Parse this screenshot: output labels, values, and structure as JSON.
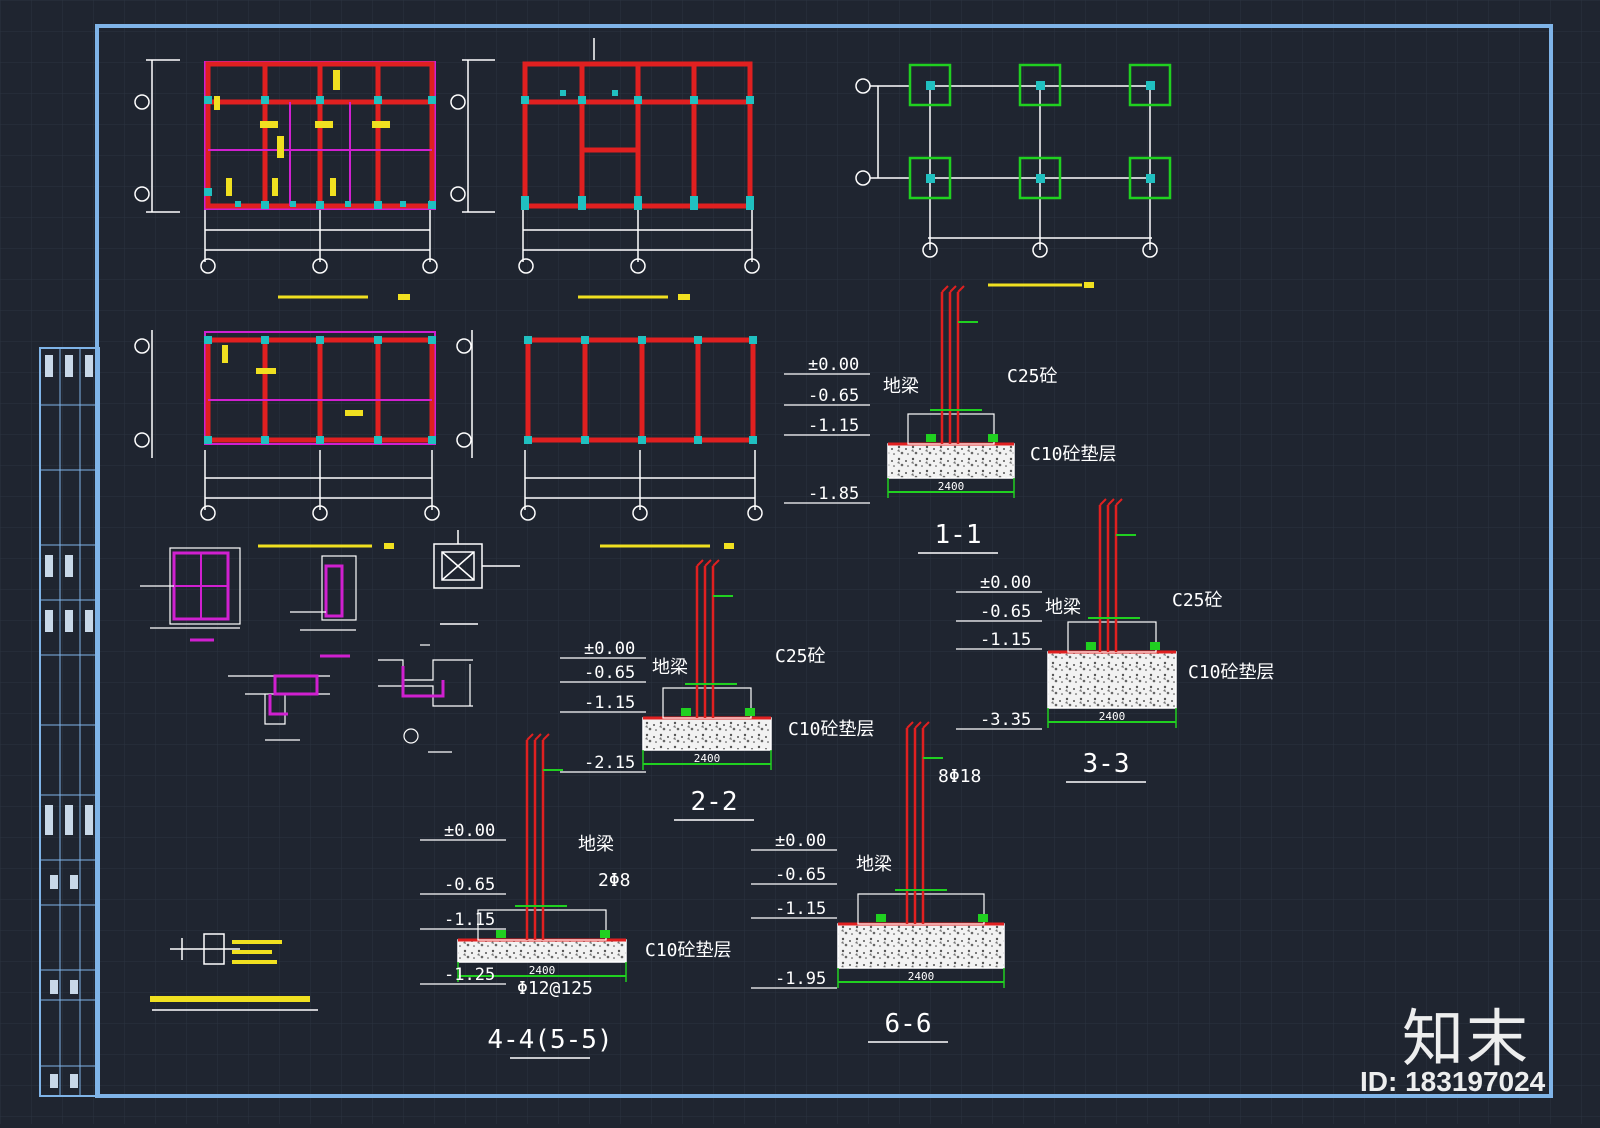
{
  "colors": {
    "background": "#1f2530",
    "grid": "#2b3340",
    "frame": "#7fb4e8",
    "beam": "#e02020",
    "wall": "#d020d0",
    "column_tie": "#20c0c0",
    "highlight": "#f0e020",
    "footing": "#20d020",
    "text": "#ffffff",
    "leader": "#20d020"
  },
  "watermark": {
    "brand": "知末",
    "image_id": "ID: 183197024"
  },
  "sections": [
    {
      "id": "1-1",
      "title": "1-1",
      "elevations": [
        "±0.00",
        "-0.65",
        "-1.15",
        "-1.85"
      ],
      "labels": [
        "地梁",
        "C25砼",
        "C10砼垫层"
      ],
      "width": "2400"
    },
    {
      "id": "2-2",
      "title": "2-2",
      "elevations": [
        "±0.00",
        "-0.65",
        "-1.15",
        "-2.15"
      ],
      "labels": [
        "地梁",
        "C25砼",
        "C10砼垫层"
      ],
      "width": "2400"
    },
    {
      "id": "3-3",
      "title": "3-3",
      "elevations": [
        "±0.00",
        "-0.65",
        "-1.15",
        "-3.35"
      ],
      "labels": [
        "地梁",
        "C25砼",
        "C10砼垫层"
      ],
      "width": "2400"
    },
    {
      "id": "4-4",
      "title": "4-4(5-5)",
      "elevations": [
        "±0.00",
        "-0.65",
        "-1.15",
        "-1.25"
      ],
      "labels": [
        "地梁",
        "2Φ8",
        "C10砼垫层",
        "Φ12@125"
      ],
      "width": "2400"
    },
    {
      "id": "6-6",
      "title": "6-6",
      "elevations": [
        "±0.00",
        "-0.65",
        "-1.15",
        "-1.95"
      ],
      "labels": [
        "地梁",
        "8Φ18"
      ],
      "width": "2400"
    }
  ]
}
